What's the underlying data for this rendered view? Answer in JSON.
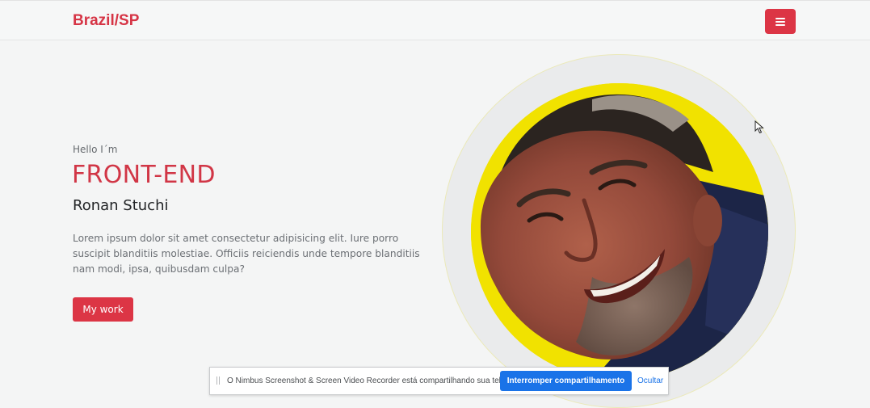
{
  "navbar": {
    "brand": "Brazil/SP",
    "menu_icon": "hamburger-icon"
  },
  "hero": {
    "greeting": "Hello I´m",
    "role": "FRONT-END",
    "name": "Ronan Stuchi",
    "description": "Lorem ipsum dolor sit amet consectetur adipisicing elit. Iure porro suscipit blanditiis molestiae. Officiis reiciendis unde tempore blanditiis nam modi, ipsa, quibusdam culpa?",
    "cta_label": "My work"
  },
  "share_bar": {
    "message": "O Nimbus Screenshot & Screen Video Recorder está compartilhando sua tela.",
    "stop_label": "Interromper compartilhamento",
    "hide_label": "Ocultar"
  },
  "colors": {
    "accent": "#dc3545",
    "portrait_background": "#f1e200",
    "share_button": "#1a73e8"
  }
}
